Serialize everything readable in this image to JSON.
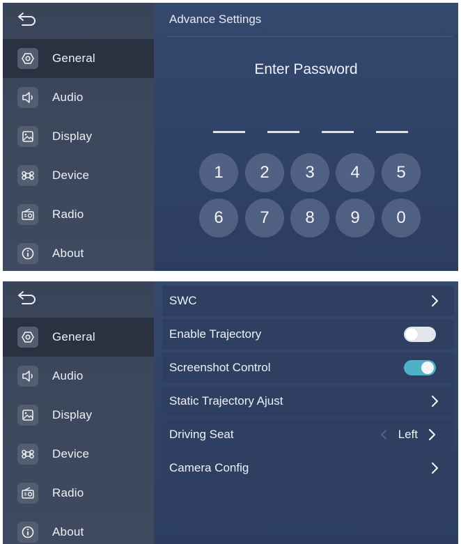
{
  "colors": {
    "accent_toggle_on": "#4fb0c6",
    "sidebar_bg": "#3c465b",
    "main_bg": "#30426a",
    "active_item_bg": "#2a3242"
  },
  "top_screen": {
    "back_icon": "back-arrow-icon",
    "sidebar": {
      "active": "General",
      "items": [
        {
          "label": "General",
          "icon": "settings-hexagon-icon"
        },
        {
          "label": "Audio",
          "icon": "speaker-icon"
        },
        {
          "label": "Display",
          "icon": "image-icon"
        },
        {
          "label": "Device",
          "icon": "command-icon"
        },
        {
          "label": "Radio",
          "icon": "radio-icon"
        },
        {
          "label": "About",
          "icon": "info-icon"
        }
      ]
    },
    "main": {
      "title": "Advance Settings",
      "prompt": "Enter Password",
      "password_slots": 4,
      "keypad": [
        "1",
        "2",
        "3",
        "4",
        "5",
        "6",
        "7",
        "8",
        "9",
        "0"
      ]
    }
  },
  "bottom_screen": {
    "back_icon": "back-arrow-icon",
    "sidebar": {
      "active": "General",
      "items": [
        {
          "label": "General",
          "icon": "settings-hexagon-icon"
        },
        {
          "label": "Audio",
          "icon": "speaker-icon"
        },
        {
          "label": "Display",
          "icon": "image-icon"
        },
        {
          "label": "Device",
          "icon": "command-icon"
        },
        {
          "label": "Radio",
          "icon": "radio-icon"
        },
        {
          "label": "About",
          "icon": "info-icon"
        }
      ]
    },
    "settings": [
      {
        "label": "SWC",
        "control": "chevron"
      },
      {
        "label": "Enable Trajectory",
        "control": "toggle",
        "value": false
      },
      {
        "label": "Screenshot Control",
        "control": "toggle",
        "value": true
      },
      {
        "label": "Static Trajectory Ajust",
        "control": "chevron"
      },
      {
        "label": "Driving Seat",
        "control": "selector",
        "value": "Left"
      },
      {
        "label": "Camera Config",
        "control": "chevron"
      }
    ]
  }
}
